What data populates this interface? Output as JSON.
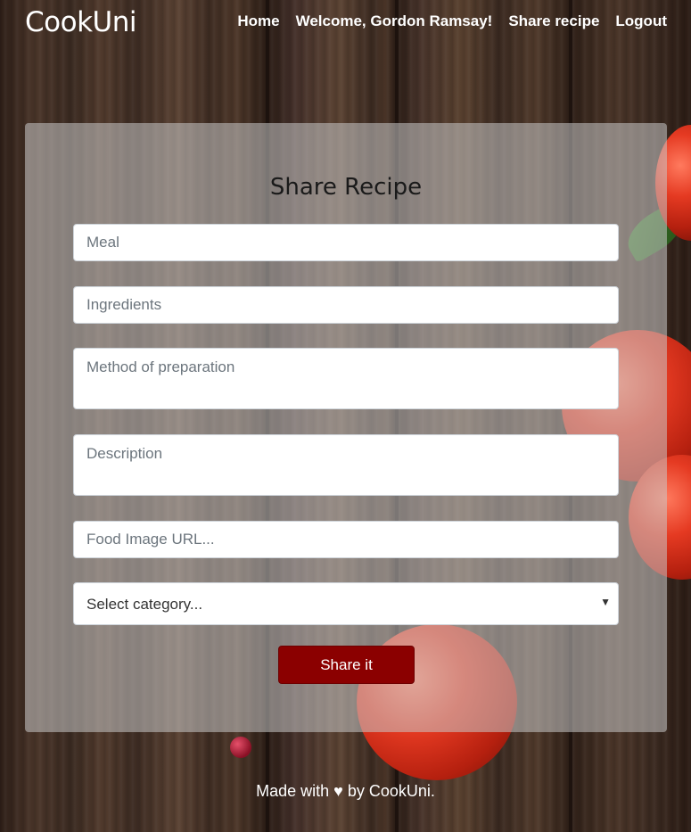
{
  "navbar": {
    "brand": "CookUni",
    "links": [
      "Home",
      "Welcome, Gordon Ramsay!",
      "Share recipe",
      "Logout"
    ]
  },
  "form": {
    "title": "Share Recipe",
    "meal_placeholder": "Meal",
    "ingredients_placeholder": "Ingredients",
    "method_placeholder": "Method of preparation",
    "description_placeholder": "Description",
    "image_placeholder": "Food Image URL...",
    "category_selected": "Select category...",
    "submit_label": "Share it"
  },
  "footer": {
    "text_before": "Made with",
    "heart": "♥",
    "text_after": "by CookUni."
  },
  "colors": {
    "submit_button": "#8b0000",
    "card_overlay": "rgba(200,200,200,0.55)"
  }
}
